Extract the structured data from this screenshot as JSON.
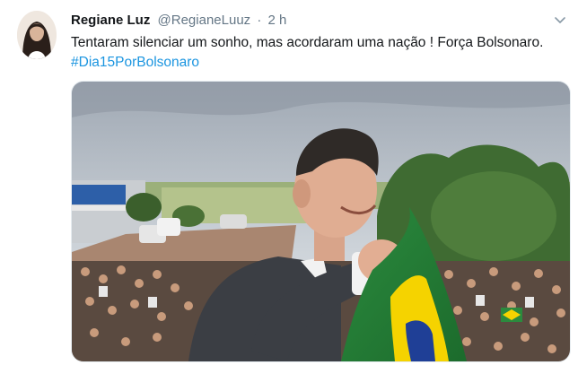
{
  "tweet": {
    "author_name": "Regiane Luz",
    "handle": "@RegianeLuuz",
    "separator": "·",
    "time": "2 h",
    "text": "Tentaram silenciar um sonho, mas acordaram uma nação ! Força Bolsonaro.",
    "hashtag": "#Dia15PorBolsonaro"
  },
  "icons": {
    "menu": "chevron-down-icon"
  },
  "colors": {
    "link": "#1b95e0",
    "secondary_text": "#657786",
    "primary_text": "#14171a"
  }
}
